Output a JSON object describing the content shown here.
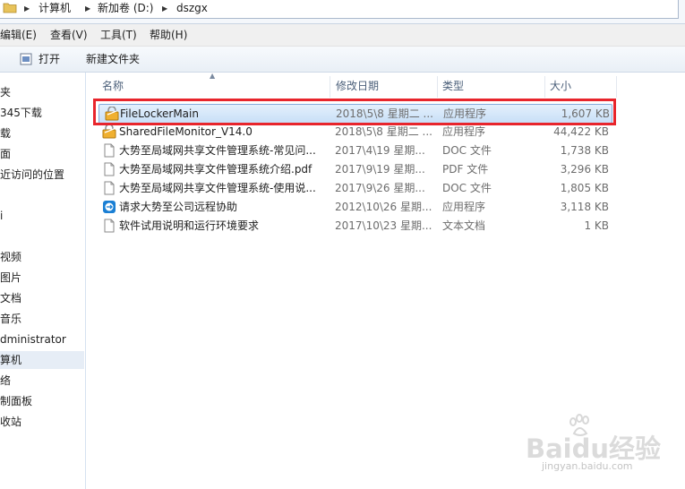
{
  "address": {
    "crumbs": [
      "计算机",
      "新加卷 (D:)",
      "dszgx"
    ]
  },
  "menu": [
    "编辑(E)",
    "查看(V)",
    "工具(T)",
    "帮助(H)"
  ],
  "toolbar": {
    "open_label": "打开",
    "new_folder_label": "新建文件夹"
  },
  "nav": {
    "items": [
      {
        "label": "夹"
      },
      {
        "label": "345下载"
      },
      {
        "label": "载"
      },
      {
        "label": "面"
      },
      {
        "label": "近访问的位置"
      },
      {
        "label": "i"
      },
      {
        "label": "视频"
      },
      {
        "label": "图片"
      },
      {
        "label": "文档"
      },
      {
        "label": "音乐"
      },
      {
        "label": "dministrator"
      },
      {
        "label": "算机"
      },
      {
        "label": "络"
      },
      {
        "label": "制面板"
      },
      {
        "label": "收站"
      }
    ]
  },
  "columns": {
    "name": "名称",
    "date": "修改日期",
    "type": "类型",
    "size": "大小"
  },
  "files": [
    {
      "name": "FileLockerMain",
      "date": "2018\\5\\8 星期二 ...",
      "type": "应用程序",
      "size": "1,607 KB",
      "icon": "filelocker-app-icon"
    },
    {
      "name": "SharedFileMonitor_V14.0",
      "date": "2018\\5\\8 星期二 ...",
      "type": "应用程序",
      "size": "44,422 KB",
      "icon": "filelocker-app-icon"
    },
    {
      "name": "大势至局域网共享文件管理系统-常见问...",
      "date": "2017\\4\\19 星期...",
      "type": "DOC 文件",
      "size": "1,738 KB",
      "icon": "document-icon"
    },
    {
      "name": "大势至局域网共享文件管理系统介绍.pdf",
      "date": "2017\\9\\19 星期...",
      "type": "PDF 文件",
      "size": "3,296 KB",
      "icon": "document-icon"
    },
    {
      "name": "大势至局域网共享文件管理系统-使用说...",
      "date": "2017\\9\\26 星期...",
      "type": "DOC 文件",
      "size": "1,805 KB",
      "icon": "document-icon"
    },
    {
      "name": "请求大势至公司远程协助",
      "date": "2012\\10\\26 星期...",
      "type": "应用程序",
      "size": "3,118 KB",
      "icon": "remote-assist-icon"
    },
    {
      "name": "软件试用说明和运行环境要求",
      "date": "2017\\10\\23 星期...",
      "type": "文本文档",
      "size": "1 KB",
      "icon": "document-icon"
    }
  ],
  "watermark": {
    "brand": "Baidu经验",
    "url": "jingyan.baidu.com"
  }
}
